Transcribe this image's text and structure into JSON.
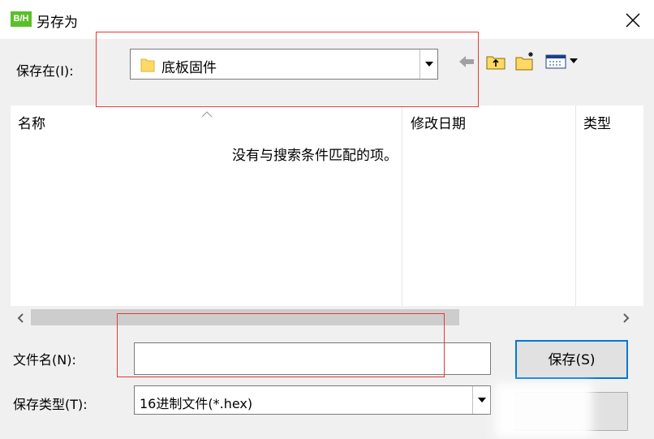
{
  "window": {
    "title": "另存为",
    "app_icon_text": "B/H"
  },
  "location": {
    "label": "保存在(I):",
    "value": "底板固件"
  },
  "toolbar": {
    "back_arrow": "back-arrow-icon",
    "up_folder": "up-folder-icon",
    "new_folder": "new-folder-icon",
    "view_menu": "view-menu-icon"
  },
  "list": {
    "columns": [
      "名称",
      "修改日期",
      "类型"
    ],
    "empty_message": "没有与搜索条件匹配的项。"
  },
  "filename": {
    "label": "文件名(N):",
    "value": ""
  },
  "filetype": {
    "label": "保存类型(T):",
    "value": "16进制文件(*.hex)"
  },
  "buttons": {
    "save": "保存(S)",
    "cancel": ""
  },
  "colors": {
    "highlight_box": "#e53935",
    "folder_yellow": "#ffd966"
  }
}
